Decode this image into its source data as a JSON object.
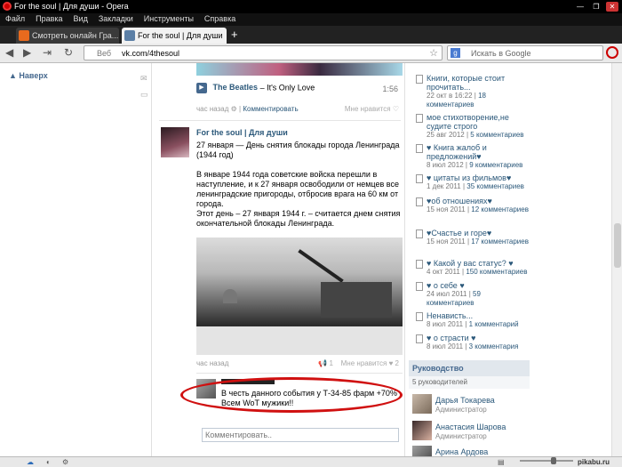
{
  "window": {
    "title": "For the soul | Для души - Opera"
  },
  "menu": [
    "Файл",
    "Правка",
    "Вид",
    "Закладки",
    "Инструменты",
    "Справка"
  ],
  "tabs": [
    {
      "label": "Смотреть онлайн Гра..."
    },
    {
      "label": "For the soul | Для души"
    }
  ],
  "address": {
    "scheme_label": "Веб",
    "url": "vk.com/4thesoul"
  },
  "search": {
    "placeholder": "Искать в Google"
  },
  "page": {
    "up_link": "Наверх",
    "audio": {
      "artist": "The Beatles",
      "title": "– It's Only Love",
      "duration": "1:56"
    },
    "prev_meta": {
      "time": "час назад",
      "comment": "Комментировать",
      "like": "Мне нравится"
    },
    "post": {
      "author": "For the soul | Для души",
      "heading": "27 января — День снятия блокады города Ленинграда (1944 год)",
      "body1": "В январе 1944 года советские войска перешли в наступление, и к 27 января освободили от немцев все ленинградские пригороды, отбросив врага на 60 км от города.",
      "body2": "Этот день – 27 января 1944 г. – считается днем снятия окончательной блокады Ленинграда.",
      "time": "час назад",
      "reposts": "1",
      "like": "Мне нравится",
      "likes": "2"
    },
    "comment": {
      "text": "В честь данного события у Т-34-85 фарм +70% Всем WoT мужики!!"
    },
    "comment_input": {
      "placeholder": "Комментировать.."
    }
  },
  "notes": [
    {
      "title": "Книги, которые стоит прочитать...",
      "date": "22 окт в 16:22",
      "count": "18 комментариев"
    },
    {
      "title": "мое стихотворение,не судите строго",
      "date": "25 авг 2012",
      "count": "5 комментариев"
    },
    {
      "title": "♥ Книга жалоб и предложений♥",
      "date": "8 июл 2012",
      "count": "9 комментариев"
    },
    {
      "title": "♥ цитаты из фильмов♥",
      "date": "1 дек 2011",
      "count": "35 комментариев"
    },
    {
      "title": "♥об отношениях♥",
      "date": "15 ноя 2011",
      "count": "12 комментариев"
    },
    {
      "title": "♥Счастье и горе♥",
      "date": "15 ноя 2011",
      "count": "17 комментариев"
    },
    {
      "title": "♥ Какой у вас статус? ♥",
      "date": "4 окт 2011",
      "count": "150 комментариев"
    },
    {
      "title": "♥ о себе ♥",
      "date": "24 июл 2011",
      "count": "59 комментариев"
    },
    {
      "title": "Ненависть...",
      "date": "8 июл 2011",
      "count": "1 комментарий"
    },
    {
      "title": "♥ о страсти ♥",
      "date": "8 июл 2011",
      "count": "3 комментария"
    }
  ],
  "leaders": {
    "heading": "Руководство",
    "count": "5 руководителей",
    "items": [
      {
        "name": "Дарья Токарева",
        "role": "Администратор"
      },
      {
        "name": "Анастасия Шарова",
        "role": "Администратор"
      },
      {
        "name": "Арина Ардова",
        "role": ""
      }
    ]
  },
  "watermark": "pikabu.ru",
  "colors": {
    "link": "#2b587a",
    "ellipse": "#d01010",
    "header_bg": "#e1e7ed"
  }
}
